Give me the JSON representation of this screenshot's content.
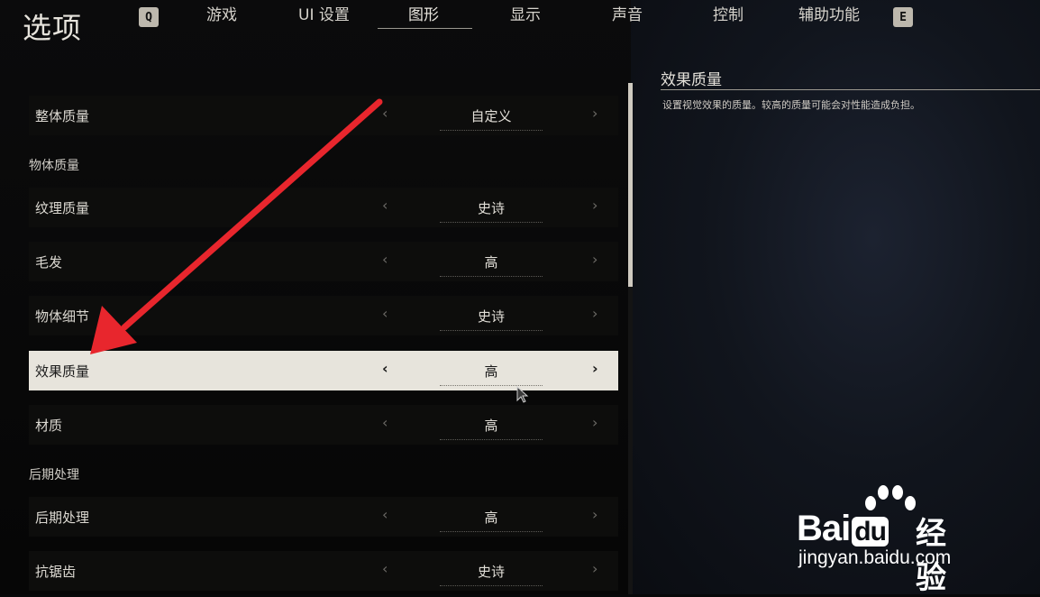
{
  "page_title": "选项",
  "nav": {
    "prev_key": "Q",
    "next_key": "E",
    "tabs": [
      {
        "label": "游戏"
      },
      {
        "label": "UI 设置"
      },
      {
        "label": "图形"
      },
      {
        "label": "显示"
      },
      {
        "label": "声音"
      },
      {
        "label": "控制"
      },
      {
        "label": "辅助功能"
      }
    ],
    "active_tab": "图形"
  },
  "settings": {
    "overall": {
      "label": "整体质量",
      "value": "自定义"
    },
    "section_object": "物体质量",
    "texture": {
      "label": "纹理质量",
      "value": "史诗"
    },
    "hair": {
      "label": "毛发",
      "value": "高"
    },
    "object_detail": {
      "label": "物体细节",
      "value": "史诗"
    },
    "effects": {
      "label": "效果质量",
      "value": "高"
    },
    "material": {
      "label": "材质",
      "value": "高"
    },
    "section_post": "后期处理",
    "post": {
      "label": "后期处理",
      "value": "高"
    },
    "aa": {
      "label": "抗锯齿",
      "value": "史诗"
    }
  },
  "selected_setting": "效果质量",
  "arrow_glyphs": {
    "left": "‹",
    "right": "›"
  },
  "description": {
    "title": "效果质量",
    "text": "设置视觉效果的质量。较高的质量可能会对性能造成负担。"
  },
  "annotation": {
    "arrow_color": "#e8262d"
  },
  "watermark": {
    "brand": "Bai",
    "brand_mid": "du",
    "brand_cn": "经验",
    "url": "jingyan.baidu.com"
  }
}
